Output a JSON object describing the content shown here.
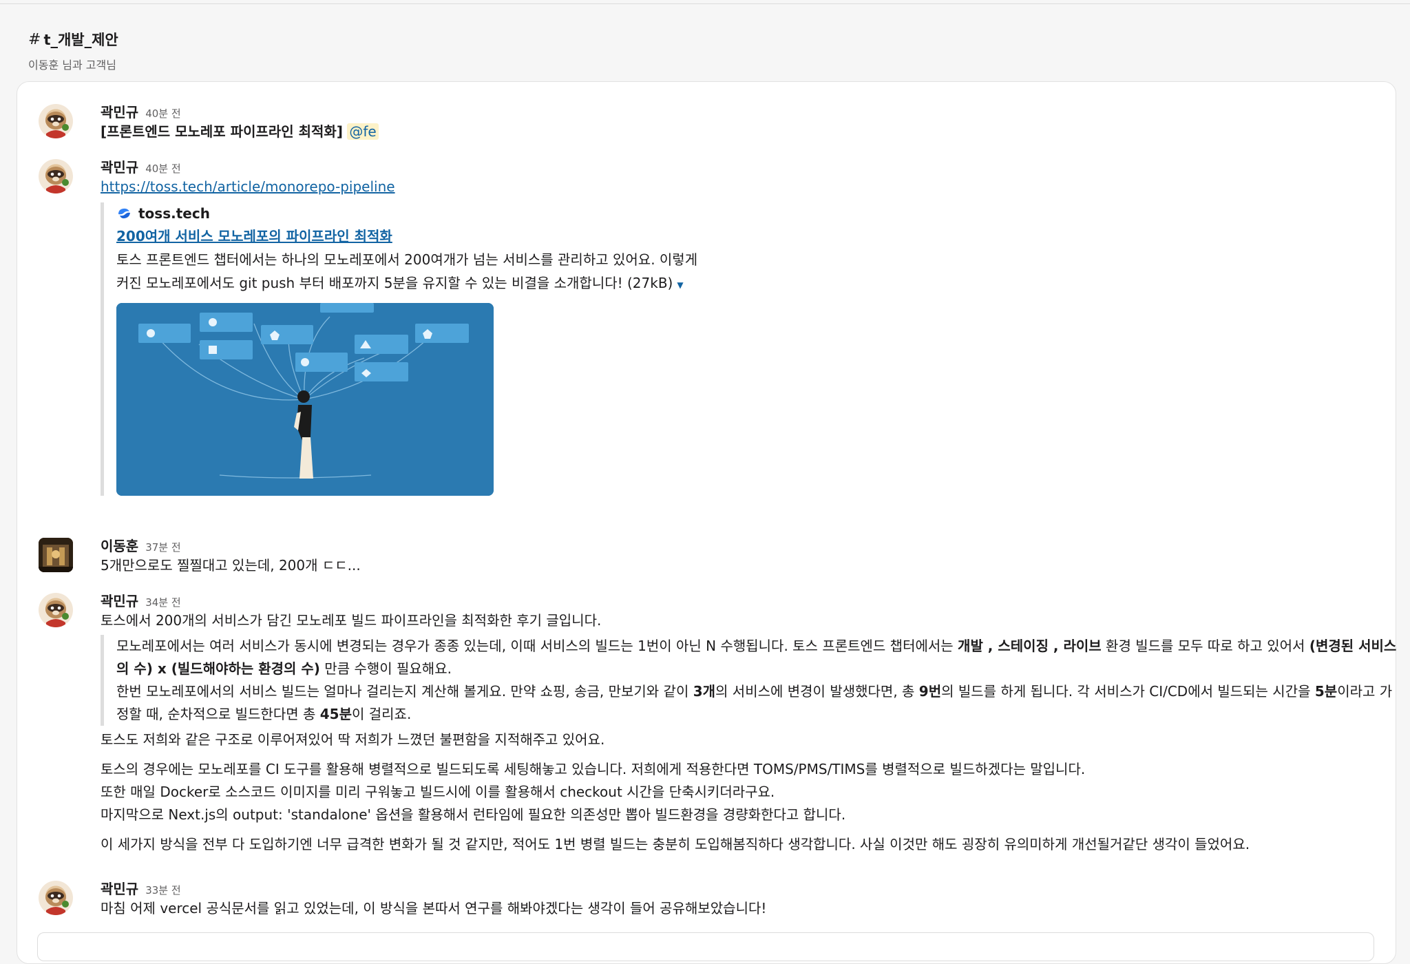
{
  "channel": {
    "name": "t_개발_제안",
    "subtitle": "이동훈 님과 고객님"
  },
  "messages": {
    "m1": {
      "author": "곽민규",
      "time": "40분 전",
      "text": "[프론트엔드 모노레포 파이프라인 최적화]",
      "mention": "@fe"
    },
    "m2": {
      "author": "곽민규",
      "time": "40분 전",
      "url": "https://toss.tech/article/monorepo-pipeline",
      "unfurl": {
        "site": "toss.tech",
        "title": "200여개 서비스 모노레포의 파이프라인 최적화",
        "description": "토스 프론트엔드 챕터에서는 하나의 모노레포에서 200여개가 넘는 서비스를 관리하고 있어요. 이렇게 커진 모노레포에서도 git push 부터 배포까지 5분을 유지할 수 있는 비결을 소개합니다! (27kB)"
      }
    },
    "m3": {
      "author": "이동훈",
      "time": "37분 전",
      "text": "5개만으로도 찔찔대고 있는데, 200개 ㄷㄷ..."
    },
    "m4": {
      "author": "곽민규",
      "time": "34분 전",
      "intro": "토스에서 200개의 서비스가 담긴 모노레포 빌드 파이프라인을 최적화한 후기 글입니다.",
      "q1_a": "모노레포에서는 여러 서비스가 동시에 변경되는 경우가 종종 있는데, 이때 서비스의 빌드는 1번이 아닌 N 수행됩니다. 토스 프론트엔드 챕터에서는 ",
      "q1_b1": "개발 , 스테이징 , 라이브",
      "q1_c": " 환경 빌드를 모두 따로 하고 있어서 ",
      "q1_b2": "(변경된 서비스의 수) x (빌드해야하는 환경의 수)",
      "q1_d": " 만큼 수행이 필요해요.",
      "q2_a": "한번 모노레포에서의 서비스 빌드는 얼마나 걸리는지 계산해 볼게요. 만약 쇼핑, 송금, 만보기와 같이 ",
      "q2_b1": "3개",
      "q2_c": "의 서비스에 변경이 발생했다면, 총 ",
      "q2_b2": "9번",
      "q2_d": "의 빌드를 하게 됩니다. 각 서비스가 CI/CD에서 빌드되는 시간을 ",
      "q2_b3": "5분",
      "q2_e": "이라고 가정할 때, 순차적으로 빌드한다면 총 ",
      "q2_b4": "45분",
      "q2_f": "이 걸리죠.",
      "p1": "토스도 저희와 같은 구조로 이루어져있어 딱 저희가 느꼈던 불편함을 지적해주고 있어요.",
      "p2": "토스의 경우에는 모노레포를 CI 도구를 활용해 병렬적으로 빌드되도록 세팅해놓고 있습니다. 저희에게 적용한다면 TOMS/PMS/TIMS를 병렬적으로 빌드하겠다는 말입니다.",
      "p3": "또한 매일 Docker로 소스코드 이미지를 미리 구워놓고 빌드시에 이를 활용해서 checkout 시간을 단축시키더라구요.",
      "p4": "마지막으로 Next.js의 output: 'standalone' 옵션을 활용해서 런타임에 필요한 의존성만 뽑아 빌드환경을 경량화한다고 합니다.",
      "p5": "이 세가지 방식을 전부 다 도입하기엔 너무 급격한 변화가 될 것 같지만, 적어도 1번 병렬 빌드는 충분히 도입해봄직하다 생각합니다. 사실 이것만 해도 굉장히 유의미하게 개선될거같단 생각이 들었어요."
    },
    "m5": {
      "author": "곽민규",
      "time": "33분 전",
      "text": "마침 어제 vercel 공식문서를 읽고 있었는데, 이 방식을 본따서 연구를 해봐야겠다는 생각이 들어 공유해보았습니다!"
    }
  }
}
